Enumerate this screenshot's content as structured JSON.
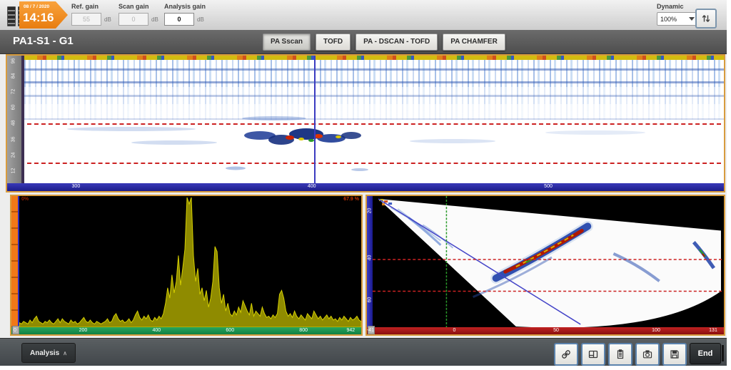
{
  "toolbar": {
    "date": "08 / 7 / 2020",
    "time": "14:16",
    "ref_gain": {
      "label": "Ref. gain",
      "value": "55",
      "unit": "dB"
    },
    "scan_gain": {
      "label": "Scan gain",
      "value": "0",
      "unit": "dB"
    },
    "analysis_gain": {
      "label": "Analysis gain",
      "value": "0",
      "unit": "dB"
    },
    "dynamic": {
      "label": "Dynamic",
      "value": "100%"
    },
    "icons": [
      "battery-icon",
      "battery-icon",
      "dropdown-arrow-icon",
      "sort-arrows-icon"
    ]
  },
  "titlebar": {
    "title": "PA1-S1 - G1",
    "tabs": [
      {
        "label": "PA Sscan",
        "active": true
      },
      {
        "label": "TOFD",
        "active": false
      },
      {
        "label": "PA - DSCAN - TOFD",
        "active": false
      },
      {
        "label": "PA CHAMFER",
        "active": false
      }
    ]
  },
  "bscan_view": {
    "y_ticks": [
      {
        "label": "96",
        "pos": 2
      },
      {
        "label": "84",
        "pos": 14
      },
      {
        "label": "72",
        "pos": 26
      },
      {
        "label": "60",
        "pos": 38.5
      },
      {
        "label": "48",
        "pos": 51
      },
      {
        "label": "36",
        "pos": 63.5
      },
      {
        "label": "24",
        "pos": 76
      },
      {
        "label": "12",
        "pos": 88.5
      }
    ],
    "x_ticks": [
      {
        "label": "300",
        "pos": 9.6
      },
      {
        "label": "400",
        "pos": 42.5
      },
      {
        "label": "500",
        "pos": 75.5
      }
    ],
    "cursor_pos_percent": 41.4
  },
  "ascan_view": {
    "corner_left": "0%",
    "corner_right": "67.9 %",
    "x_ticks": [
      {
        "label": "0",
        "pos": 1.0
      },
      {
        "label": "200",
        "pos": 20.5
      },
      {
        "label": "400",
        "pos": 41.5
      },
      {
        "label": "600",
        "pos": 62.5
      },
      {
        "label": "800",
        "pos": 83.5
      },
      {
        "label": "942",
        "pos": 97.0
      }
    ],
    "waveform": [
      3,
      2,
      4,
      3,
      2,
      5,
      3,
      6,
      8,
      4,
      3,
      2,
      4,
      3,
      5,
      3,
      2,
      4,
      6,
      3,
      6,
      4,
      3,
      2,
      5,
      3,
      4,
      2,
      3,
      5,
      7,
      4,
      3,
      5,
      3,
      2,
      4,
      3,
      2,
      3,
      4,
      6,
      3,
      4,
      8,
      10,
      6,
      4,
      5,
      3,
      4,
      6,
      3,
      5,
      9,
      12,
      7,
      5,
      8,
      6,
      9,
      5,
      4,
      7,
      5,
      8,
      6,
      10,
      18,
      30,
      22,
      40,
      26,
      35,
      55,
      32,
      45,
      60,
      100,
      95,
      100,
      55,
      35,
      45,
      25,
      30,
      20,
      28,
      15,
      22,
      35,
      62,
      58,
      30,
      18,
      25,
      12,
      18,
      10,
      8,
      12,
      9,
      15,
      11,
      20,
      16,
      12,
      9,
      18,
      8,
      12,
      10,
      8,
      15,
      10,
      7,
      8,
      6,
      9,
      7,
      10,
      25,
      28,
      22,
      12,
      8,
      10,
      7,
      12,
      8,
      6,
      9,
      7,
      5,
      10,
      8,
      6,
      12,
      9,
      6,
      8,
      5,
      7,
      9,
      6,
      8,
      5,
      6,
      4,
      7,
      5,
      8,
      6,
      4,
      7,
      5,
      6,
      8,
      5,
      4
    ]
  },
  "sscan_view": {
    "y_ticks": [
      {
        "label": "20",
        "pos": 9
      },
      {
        "label": "40",
        "pos": 45
      },
      {
        "label": "60",
        "pos": 77
      }
    ],
    "x_ticks": [
      {
        "label": "-41",
        "pos": 1.0
      },
      {
        "label": "0",
        "pos": 24.5
      },
      {
        "label": "50",
        "pos": 53.0
      },
      {
        "label": "100",
        "pos": 81.0
      },
      {
        "label": "131",
        "pos": 97.0
      }
    ]
  },
  "bottombar": {
    "analysis_label": "Analysis",
    "analysis_caret": "∧",
    "end_label": "End",
    "icons": [
      "link-icon",
      "layout-icon",
      "report-icon",
      "camera-icon",
      "save-icon"
    ]
  },
  "colors": {
    "accent_orange": "#f08418",
    "view_border": "#d89c3e",
    "axis_blue": "#2626a8",
    "axis_green": "#1a9950",
    "axis_red": "#a81414",
    "gate_red": "#cc2222",
    "cursor_blue": "#3b3bc0",
    "waveform_yellow": "#c8c400"
  }
}
